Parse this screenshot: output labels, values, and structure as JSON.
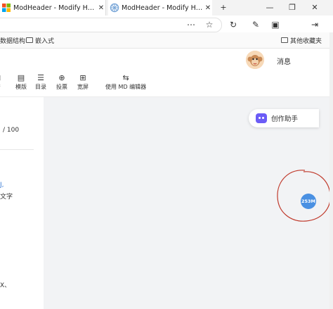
{
  "browser": {
    "tabs": [
      {
        "title": "ModHeader - Modify HTTP heade",
        "close": "✕"
      },
      {
        "title": "ModHeader - Modify HTTP heade",
        "close": "✕"
      }
    ],
    "new_tab": "+",
    "window_controls": {
      "minimize": "—",
      "restore": "❐",
      "close": "✕"
    },
    "toolbar_icons": {
      "more": "⋯",
      "favorite": "☆",
      "refresh": "↻",
      "collections": "✎",
      "screen": "▣",
      "exit": "⇥"
    }
  },
  "bookmarks": {
    "left_partial": "数据结构",
    "embedded": "嵌入式",
    "other": "其他收藏夹"
  },
  "header": {
    "messages": "消息"
  },
  "toolbar": {
    "items": [
      {
        "label": "糖",
        "icon": "⊡"
      },
      {
        "label": "模版",
        "icon": "▤"
      },
      {
        "label": "目录",
        "icon": "☰"
      },
      {
        "label": "投票",
        "icon": "⊕"
      },
      {
        "label": "宽屏",
        "icon": "⊞"
      },
      {
        "label": "使用 MD 编辑器",
        "icon": "⇆"
      }
    ]
  },
  "editor": {
    "counter": "/ 100",
    "line_a": "J,",
    "line_b": "文字",
    "line_c": "X、"
  },
  "assistant": {
    "label": "创作助手"
  },
  "badge": {
    "text": "253M"
  },
  "colors": {
    "accent": "#4a90e2",
    "assistant_icon": "#6b5cf6",
    "annotation_circle": "#c0392b"
  }
}
